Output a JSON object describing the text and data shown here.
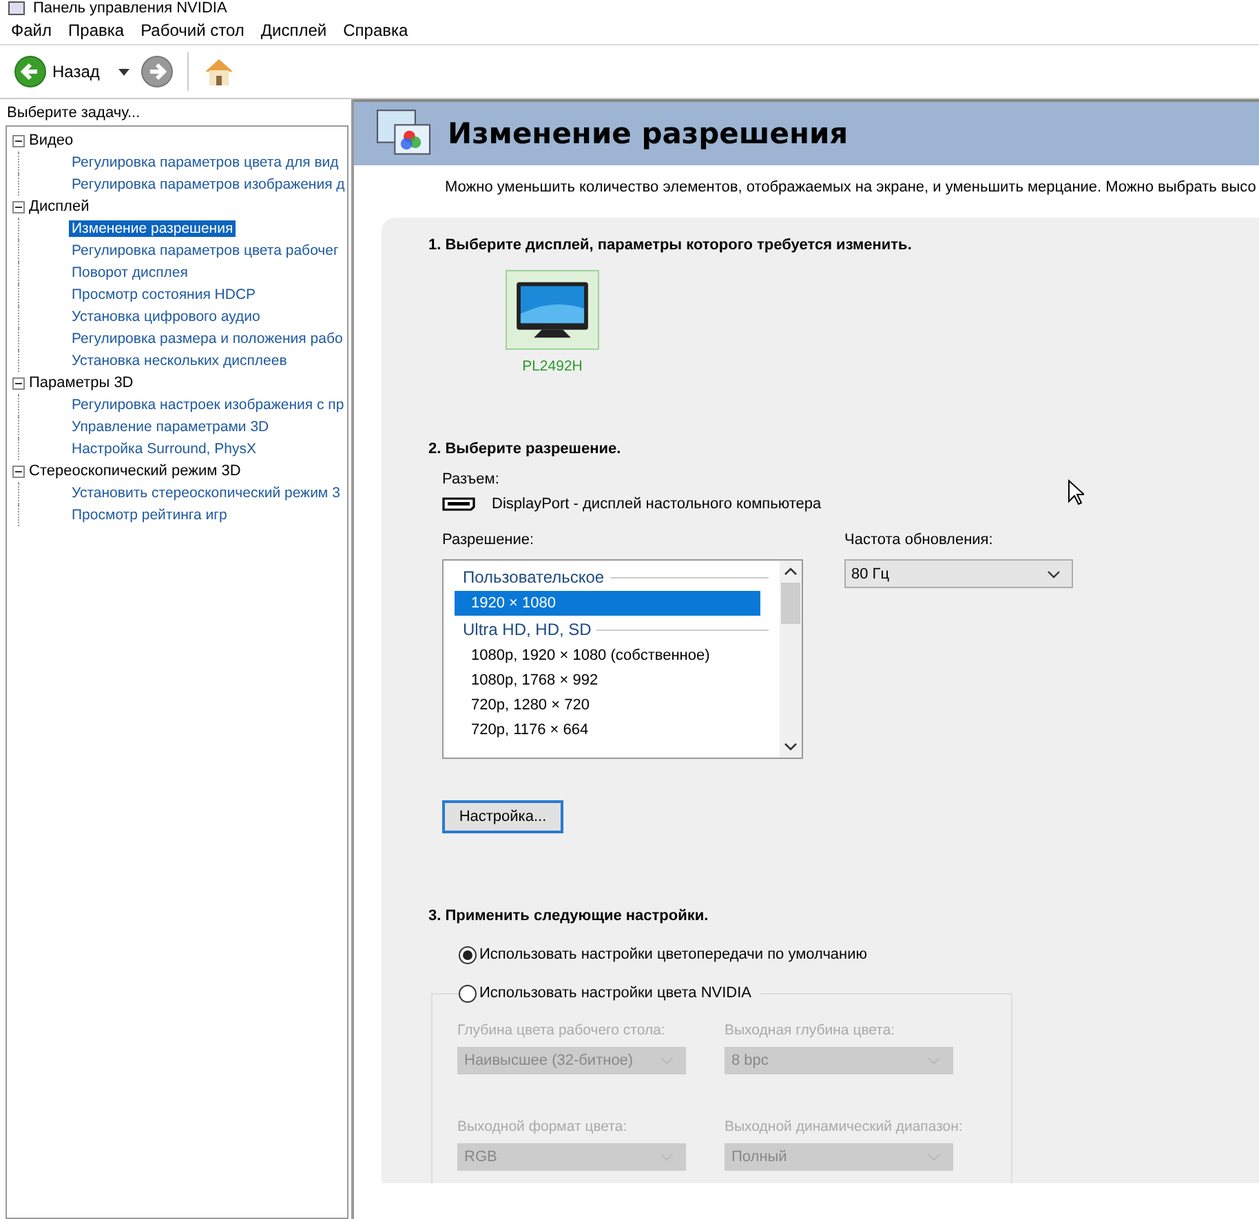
{
  "window": {
    "title": "Панель управления NVIDIA"
  },
  "menu": [
    "Файл",
    "Правка",
    "Рабочий стол",
    "Дисплей",
    "Справка"
  ],
  "toolbar": {
    "back_label": "Назад"
  },
  "sidebar": {
    "heading": "Выберите задачу...",
    "tree": [
      {
        "label": "Видео",
        "expanded": true,
        "children": [
          {
            "label": "Регулировка параметров цвета для вид",
            "selected": false
          },
          {
            "label": "Регулировка параметров изображения д",
            "selected": false
          }
        ]
      },
      {
        "label": "Дисплей",
        "expanded": true,
        "children": [
          {
            "label": "Изменение разрешения",
            "selected": true
          },
          {
            "label": "Регулировка параметров цвета рабочег",
            "selected": false
          },
          {
            "label": "Поворот дисплея",
            "selected": false
          },
          {
            "label": "Просмотр состояния HDCP",
            "selected": false
          },
          {
            "label": "Установка цифрового аудио",
            "selected": false
          },
          {
            "label": "Регулировка размера и положения рабо",
            "selected": false
          },
          {
            "label": "Установка нескольких дисплеев",
            "selected": false
          }
        ]
      },
      {
        "label": "Параметры 3D",
        "expanded": true,
        "children": [
          {
            "label": "Регулировка настроек изображения с пр",
            "selected": false
          },
          {
            "label": "Управление параметрами 3D",
            "selected": false
          },
          {
            "label": "Настройка Surround, PhysX",
            "selected": false
          }
        ]
      },
      {
        "label": "Стереоскопический режим 3D",
        "expanded": true,
        "children": [
          {
            "label": "Установить стереоскопический режим 3",
            "selected": false
          },
          {
            "label": "Просмотр рейтинга игр",
            "selected": false
          }
        ]
      }
    ]
  },
  "page": {
    "title": "Изменение разрешения",
    "description": "Можно уменьшить количество элементов, отображаемых на экране, и уменьшить мерцание. Можно выбрать высо",
    "step1": {
      "heading": "1. Выберите дисплей, параметры которого требуется изменить.",
      "displays": [
        {
          "name": "PL2492H",
          "selected": true
        }
      ]
    },
    "step2": {
      "heading": "2. Выберите разрешение.",
      "connector_label": "Разъем:",
      "connector": "DisplayPort - дисплей настольного компьютера",
      "resolution_label": "Разрешение:",
      "resolutions": [
        {
          "kind": "group",
          "label": "Пользовательское"
        },
        {
          "kind": "item",
          "label": "1920 × 1080",
          "selected": true
        },
        {
          "kind": "group",
          "label": "Ultra HD, HD, SD"
        },
        {
          "kind": "item",
          "label": "1080p, 1920 × 1080 (собственное)",
          "selected": false
        },
        {
          "kind": "item",
          "label": "1080p, 1768 × 992",
          "selected": false
        },
        {
          "kind": "item",
          "label": "720p, 1280 × 720",
          "selected": false
        },
        {
          "kind": "item",
          "label": "720p, 1176 × 664",
          "selected": false
        }
      ],
      "refresh_label": "Частота обновления:",
      "refresh_value": "80 Гц",
      "customize_button": "Настройка..."
    },
    "step3": {
      "heading": "3. Применить следующие настройки.",
      "options": [
        {
          "label": "Использовать настройки цветопередачи по умолчанию",
          "selected": true
        },
        {
          "label": "Использовать настройки цвета NVIDIA",
          "selected": false
        }
      ],
      "fields": [
        {
          "label": "Глубина цвета рабочего стола:",
          "value": "Наивысшее (32-битное)",
          "disabled": true
        },
        {
          "label": "Выходная глубина цвета:",
          "value": "8 bpc",
          "disabled": true
        },
        {
          "label": "Выходной формат цвета:",
          "value": "RGB",
          "disabled": true
        },
        {
          "label": "Выходной динамический диапазон:",
          "value": "Полный",
          "disabled": true
        }
      ]
    }
  }
}
